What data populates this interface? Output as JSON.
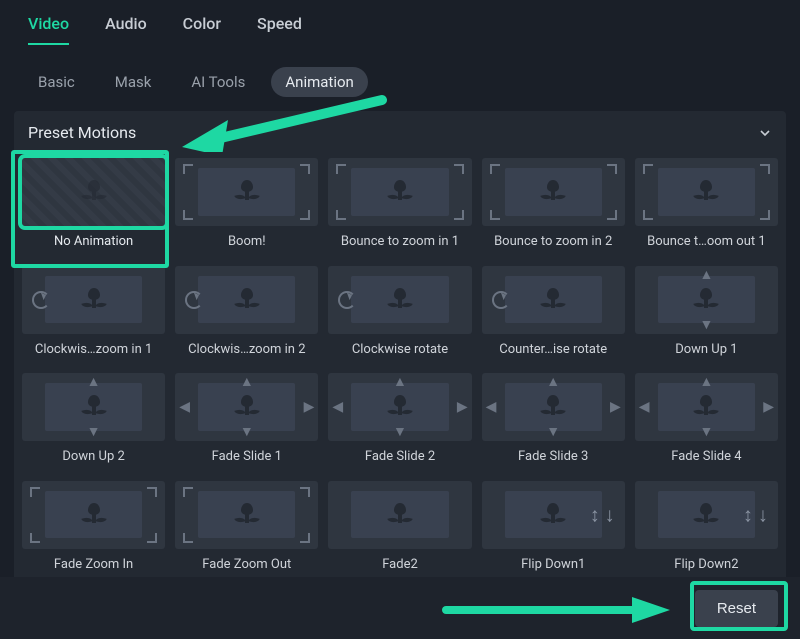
{
  "accent": "#1ed8a3",
  "main_tabs": {
    "items": [
      "Video",
      "Audio",
      "Color",
      "Speed"
    ],
    "active_index": 0
  },
  "sub_tabs": {
    "items": [
      "Basic",
      "Mask",
      "AI Tools",
      "Animation"
    ],
    "active_index": 3
  },
  "section": {
    "title": "Preset Motions"
  },
  "presets": [
    {
      "label": "No Animation",
      "selected": true,
      "deco": "hatched"
    },
    {
      "label": "Boom!",
      "selected": false,
      "deco": "corners-out"
    },
    {
      "label": "Bounce to zoom in 1",
      "selected": false,
      "deco": "corners-in"
    },
    {
      "label": "Bounce to zoom in 2",
      "selected": false,
      "deco": "corners-in"
    },
    {
      "label": "Bounce t…oom out 1",
      "selected": false,
      "deco": "corners-out"
    },
    {
      "label": "Clockwis…zoom in 1",
      "selected": false,
      "deco": "rotate"
    },
    {
      "label": "Clockwis…zoom in 2",
      "selected": false,
      "deco": "rotate"
    },
    {
      "label": "Clockwise rotate",
      "selected": false,
      "deco": "rotate"
    },
    {
      "label": "Counter…ise rotate",
      "selected": false,
      "deco": "rotate"
    },
    {
      "label": "Down Up 1",
      "selected": false,
      "deco": "updown"
    },
    {
      "label": "Down Up 2",
      "selected": false,
      "deco": "updown"
    },
    {
      "label": "Fade Slide 1",
      "selected": false,
      "deco": "slide"
    },
    {
      "label": "Fade Slide 2",
      "selected": false,
      "deco": "slide"
    },
    {
      "label": "Fade Slide 3",
      "selected": false,
      "deco": "slide"
    },
    {
      "label": "Fade Slide 4",
      "selected": false,
      "deco": "slide"
    },
    {
      "label": "Fade Zoom In",
      "selected": false,
      "deco": "corners-out"
    },
    {
      "label": "Fade Zoom Out",
      "selected": false,
      "deco": "corners-in"
    },
    {
      "label": "Fade2",
      "selected": false,
      "deco": "none"
    },
    {
      "label": "Flip Down1",
      "selected": false,
      "deco": "flip"
    },
    {
      "label": "Flip Down2",
      "selected": false,
      "deco": "flip"
    }
  ],
  "footer": {
    "reset_label": "Reset"
  }
}
